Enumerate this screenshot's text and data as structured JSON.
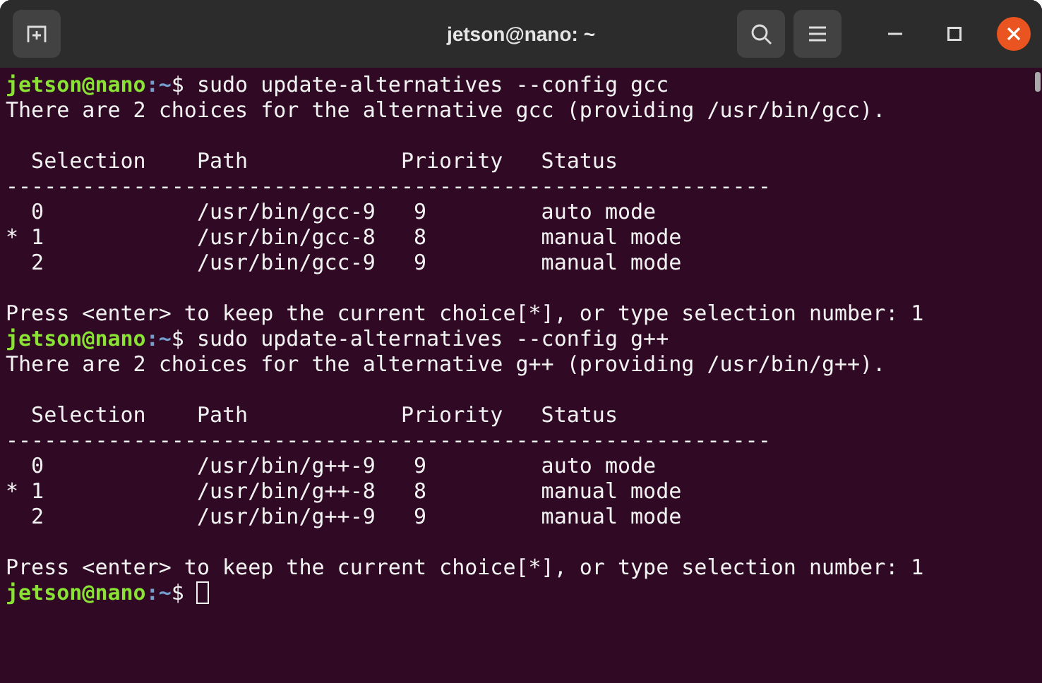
{
  "window": {
    "title": "jetson@nano: ~"
  },
  "terminal": {
    "lines": [
      {
        "kind": "prompt",
        "user_host": "jetson@nano",
        "path": ":~",
        "command": "$ sudo update-alternatives --config gcc"
      },
      {
        "kind": "output",
        "text": "There are 2 choices for the alternative gcc (providing /usr/bin/gcc)."
      },
      {
        "kind": "blank"
      },
      {
        "kind": "output",
        "text": "  Selection    Path            Priority   Status"
      },
      {
        "kind": "output",
        "text": "------------------------------------------------------------"
      },
      {
        "kind": "output",
        "text": "  0            /usr/bin/gcc-9   9         auto mode"
      },
      {
        "kind": "output",
        "text": "* 1            /usr/bin/gcc-8   8         manual mode"
      },
      {
        "kind": "output",
        "text": "  2            /usr/bin/gcc-9   9         manual mode"
      },
      {
        "kind": "blank"
      },
      {
        "kind": "output",
        "text": "Press <enter> to keep the current choice[*], or type selection number: 1"
      },
      {
        "kind": "prompt",
        "user_host": "jetson@nano",
        "path": ":~",
        "command": "$ sudo update-alternatives --config g++"
      },
      {
        "kind": "output",
        "text": "There are 2 choices for the alternative g++ (providing /usr/bin/g++)."
      },
      {
        "kind": "blank"
      },
      {
        "kind": "output",
        "text": "  Selection    Path            Priority   Status"
      },
      {
        "kind": "output",
        "text": "------------------------------------------------------------"
      },
      {
        "kind": "output",
        "text": "  0            /usr/bin/g++-9   9         auto mode"
      },
      {
        "kind": "output",
        "text": "* 1            /usr/bin/g++-8   8         manual mode"
      },
      {
        "kind": "output",
        "text": "  2            /usr/bin/g++-9   9         manual mode"
      },
      {
        "kind": "blank"
      },
      {
        "kind": "output",
        "text": "Press <enter> to keep the current choice[*], or type selection number: 1"
      },
      {
        "kind": "prompt",
        "user_host": "jetson@nano",
        "path": ":~",
        "command": "$",
        "cursor": true
      }
    ]
  }
}
